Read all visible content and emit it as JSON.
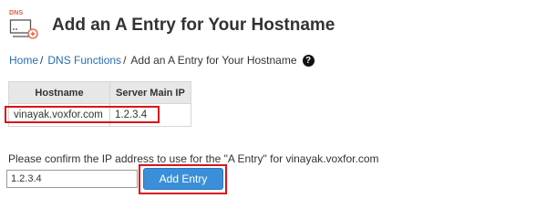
{
  "header": {
    "icon_tag": "DNS",
    "title": "Add an A Entry for Your Hostname"
  },
  "breadcrumb": {
    "items": [
      "Home",
      "DNS Functions"
    ],
    "separator": "/",
    "current": "Add an A Entry for Your Hostname",
    "help_glyph": "?"
  },
  "table": {
    "columns": [
      "Hostname",
      "Server Main IP"
    ],
    "rows": [
      [
        "vinayak.voxfor.com",
        "1.2.3.4"
      ]
    ]
  },
  "form": {
    "prompt": "Please confirm the IP address to use for the \"A Entry\" for vinayak.voxfor.com",
    "ip_value": "1.2.3.4",
    "submit_label": "Add Entry"
  },
  "colors": {
    "link": "#2a6db0",
    "highlight": "#d9141a",
    "button": "#3b8fd8",
    "icon_accent": "#e25a3b"
  }
}
